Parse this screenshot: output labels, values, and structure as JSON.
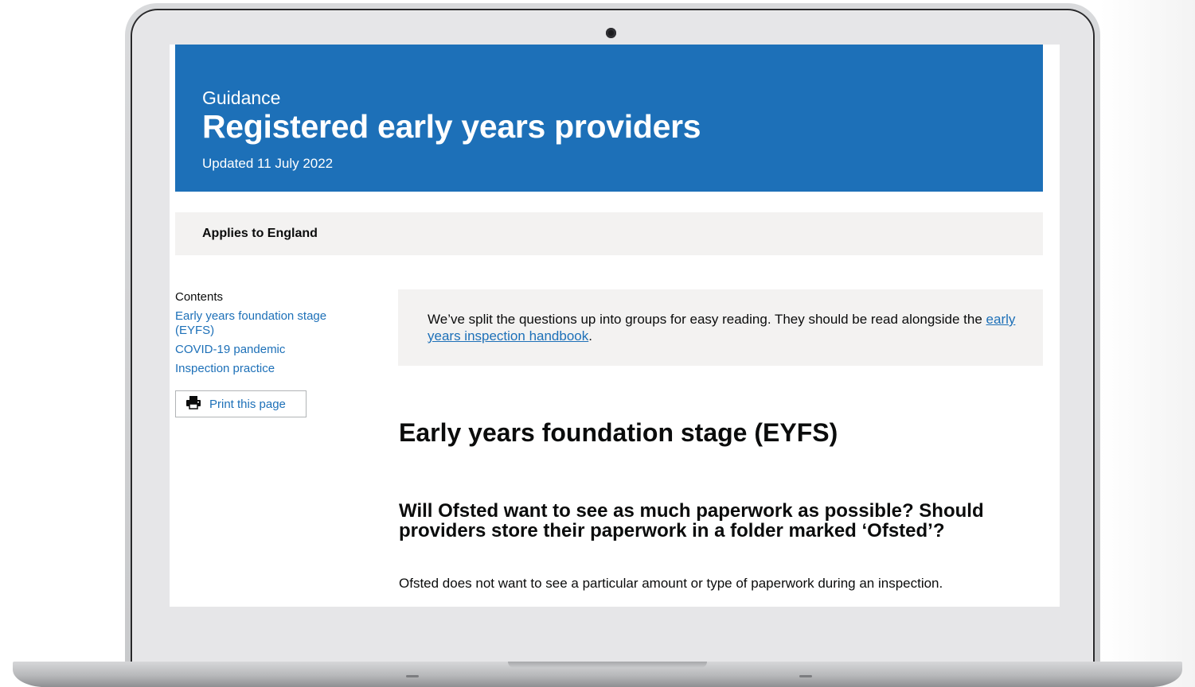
{
  "hero": {
    "kicker": "Guidance",
    "title": "Registered early years providers",
    "updated": "Updated 11 July 2022"
  },
  "applies_to": "Applies to England",
  "sidebar": {
    "contents_heading": "Contents",
    "links": [
      "Early years foundation stage (EYFS)",
      "COVID-19 pandemic",
      "Inspection practice"
    ],
    "print_label": "Print this page"
  },
  "callout": {
    "text_before": "We’ve split the questions up into groups for easy reading. They should be read alongside the ",
    "link_text": "early years inspection handbook",
    "text_after": "."
  },
  "main": {
    "section_heading": "Early years foundation stage (EYFS)",
    "question_heading": "Will Ofsted want to see as much paperwork as possible? Should providers store their paperwork in a folder marked ‘Ofsted’?",
    "answer_text": "Ofsted does not want to see a particular amount or type of paperwork during an inspection."
  },
  "colors": {
    "brand_blue": "#1d70b8",
    "panel_grey": "#f3f2f1",
    "text": "#0b0c0c"
  },
  "icons": {
    "print": "printer-icon"
  }
}
